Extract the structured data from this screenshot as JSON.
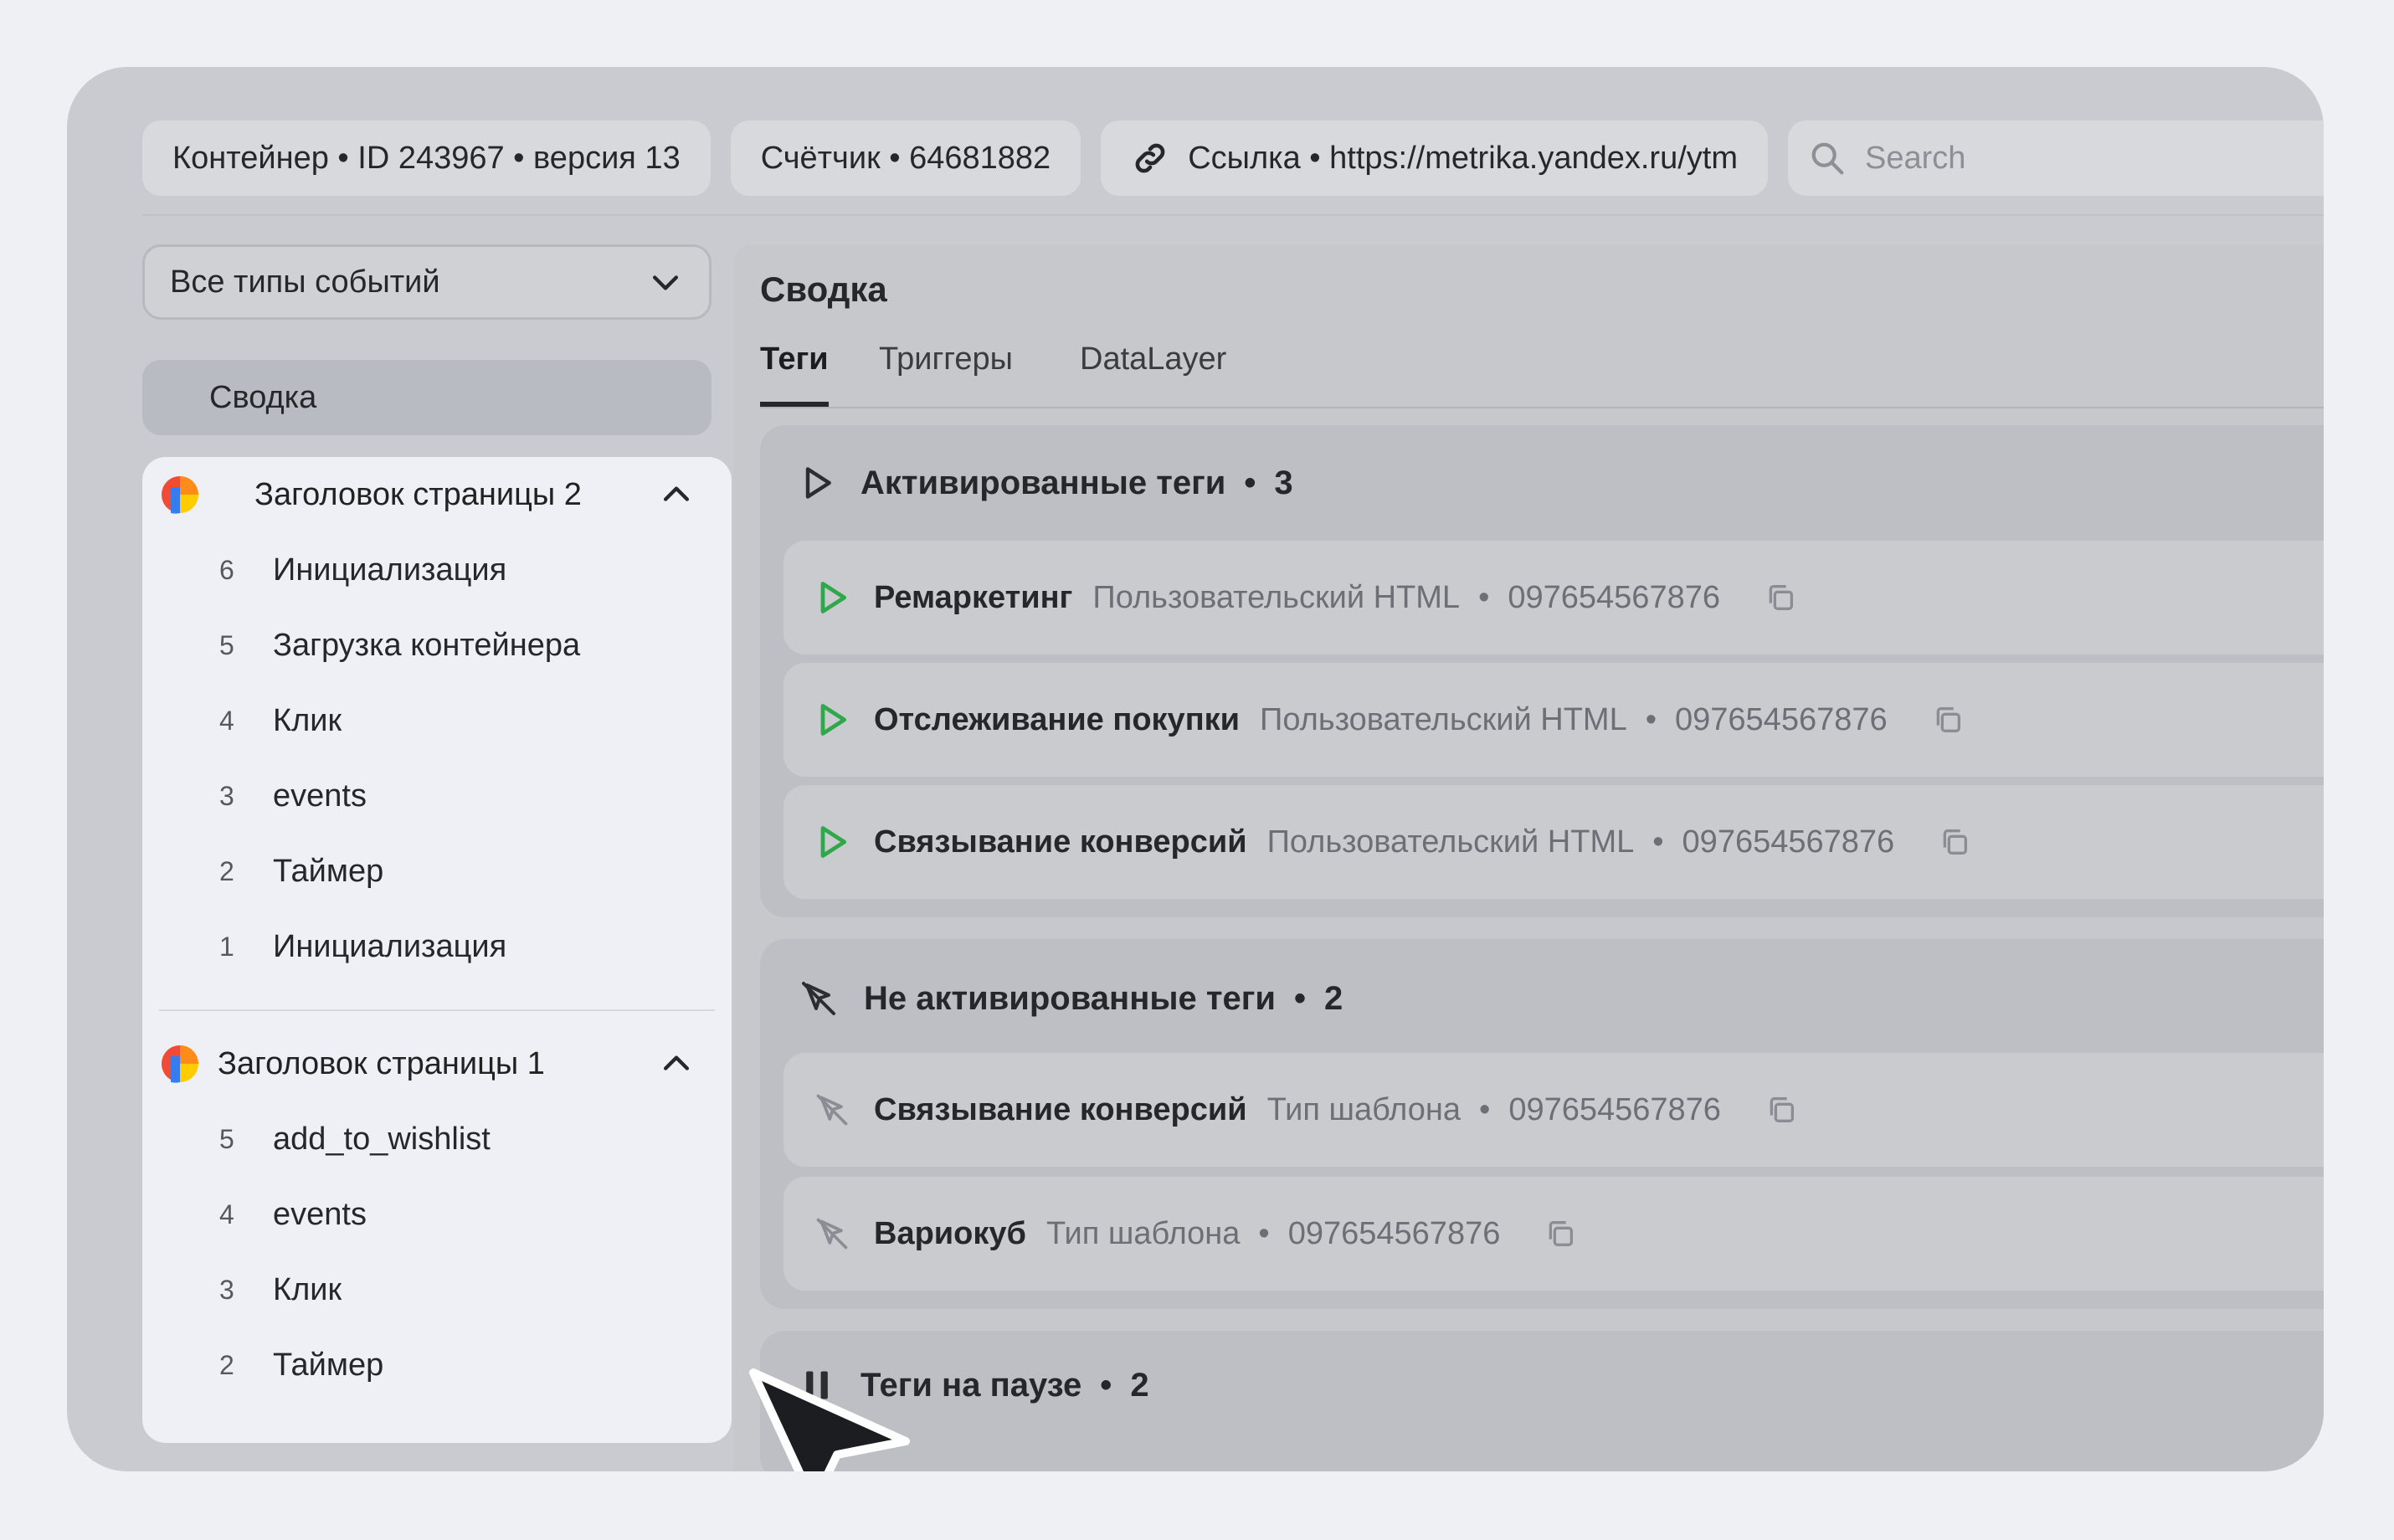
{
  "topbar": {
    "container_label": "Контейнер • ID 243967 • версия 13",
    "counter_label": "Счётчик • 64681882",
    "link_label": "Ссылка • https://metrika.yandex.ru/ytm",
    "search_placeholder": "Search"
  },
  "sidebar": {
    "filter_value": "Все типы событий",
    "summary_label": "Сводка",
    "groups": [
      {
        "title": "Заголовок страницы 2",
        "items": [
          {
            "num": "6",
            "label": "Инициализация"
          },
          {
            "num": "5",
            "label": "Загрузка контейнера"
          },
          {
            "num": "4",
            "label": "Клик"
          },
          {
            "num": "3",
            "label": "events"
          },
          {
            "num": "2",
            "label": "Таймер"
          },
          {
            "num": "1",
            "label": "Инициализация"
          }
        ]
      },
      {
        "title": "Заголовок страницы 1",
        "items": [
          {
            "num": "5",
            "label": "add_to_wishlist"
          },
          {
            "num": "4",
            "label": "events"
          },
          {
            "num": "3",
            "label": "Клик"
          },
          {
            "num": "2",
            "label": "Таймер"
          }
        ]
      }
    ]
  },
  "main": {
    "title": "Сводка",
    "tabs": [
      "Теги",
      "Триггеры",
      "DataLayer"
    ],
    "sections": [
      {
        "title": "Активированные теги",
        "count": "3",
        "tags": [
          {
            "name": "Ремаркетинг",
            "type": "Пользовательский HTML",
            "id": "097654567876"
          },
          {
            "name": "Отслеживание покупки",
            "type": "Пользовательский HTML",
            "id": "097654567876"
          },
          {
            "name": "Связывание конверсий",
            "type": "Пользовательский HTML",
            "id": "097654567876"
          }
        ]
      },
      {
        "title": "Не активированные теги",
        "count": "2",
        "tags": [
          {
            "name": "Связывание конверсий",
            "type": "Тип шаблона",
            "id": "097654567876"
          },
          {
            "name": "Вариокуб",
            "type": "Тип шаблона",
            "id": "097654567876"
          }
        ]
      },
      {
        "title": "Теги на паузе",
        "count": "2",
        "tags": []
      }
    ]
  },
  "colors": {
    "play_green": "#2ea84a",
    "dark_icon": "#2b2d31",
    "muted_icon": "#8a8d93"
  }
}
